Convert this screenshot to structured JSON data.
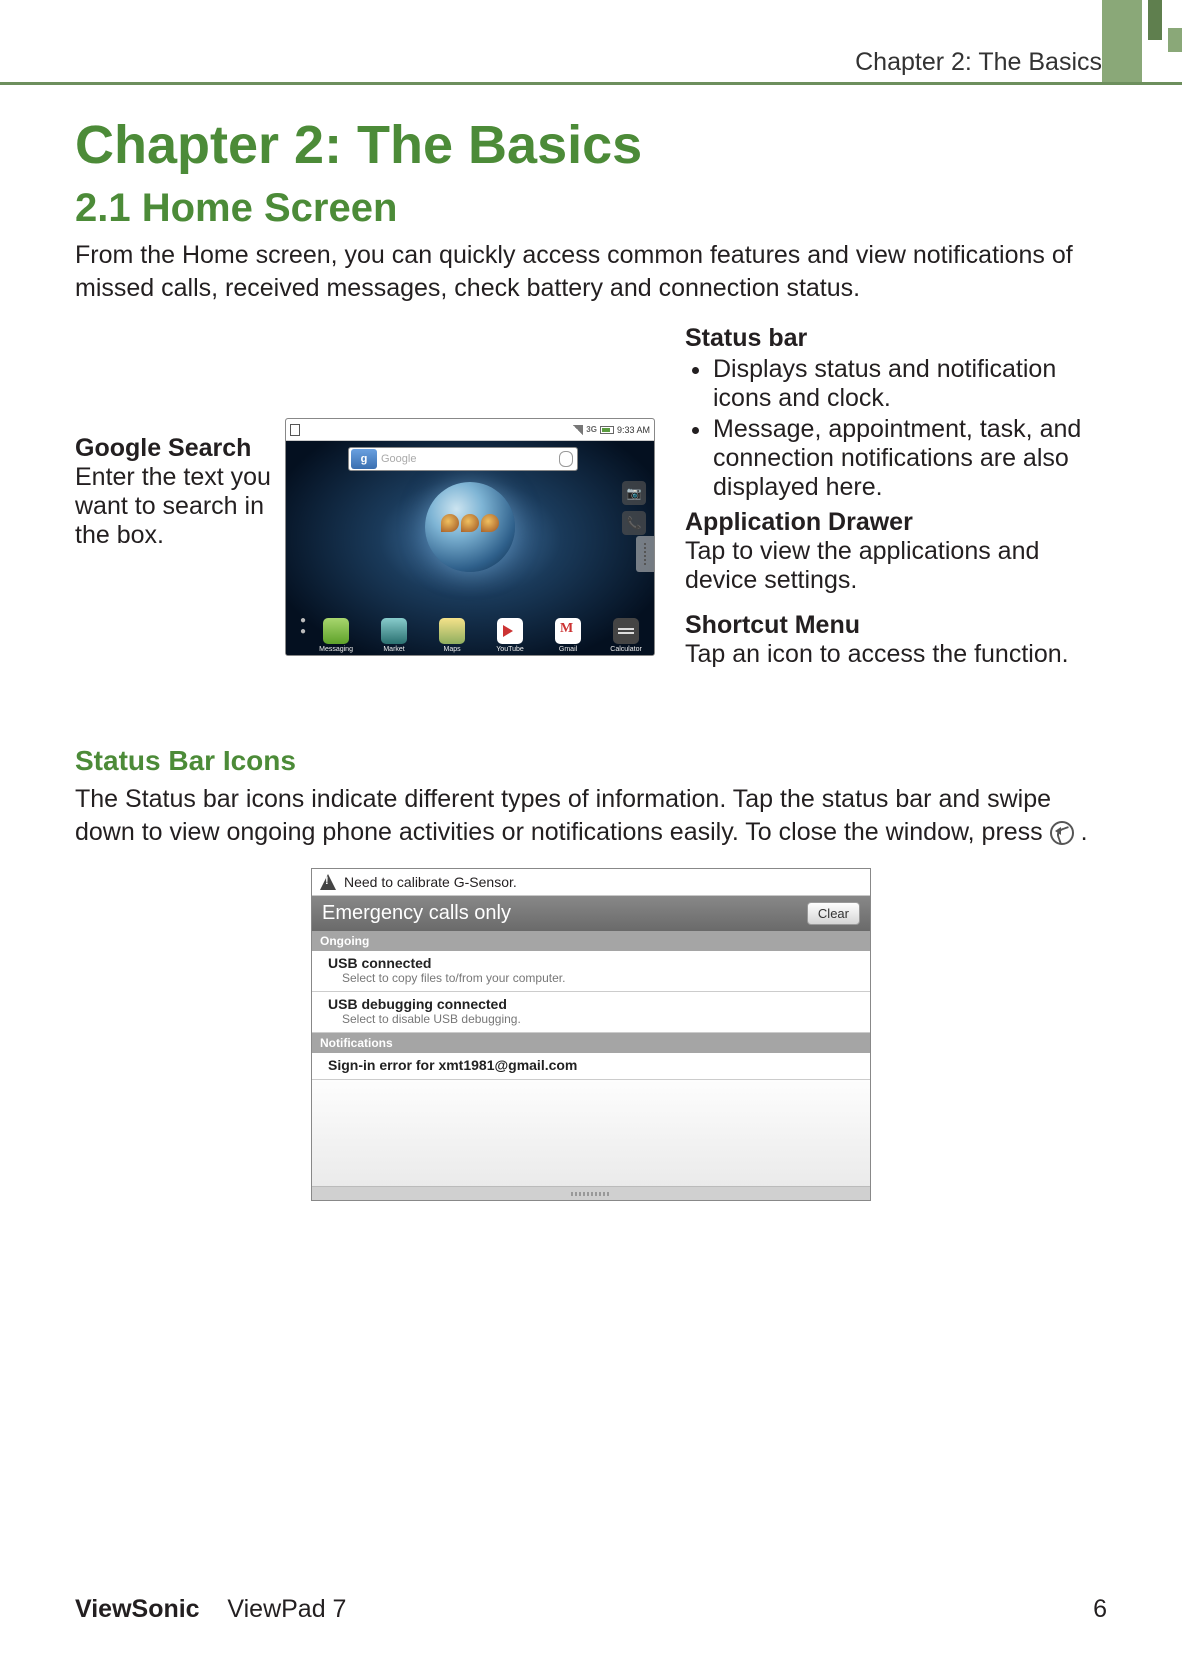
{
  "header": {
    "running": "Chapter 2: The Basics"
  },
  "section": {
    "chapter_title": "Chapter 2: The Basics",
    "h2": "2.1 Home Screen",
    "intro": "From the Home screen, you can quickly access common features and view notifications of missed calls, received messages, check battery and connection status."
  },
  "callouts": {
    "google_search": {
      "title": "Google Search",
      "desc": "Enter the text you want to search in the box."
    },
    "status_bar": {
      "title": "Status bar",
      "bullets": [
        "Displays status and notification icons and clock.",
        "Message, appointment, task, and connection notifications are also displayed here."
      ]
    },
    "app_drawer": {
      "title": "Application Drawer",
      "desc": "Tap to view the applications and device settings."
    },
    "shortcut_menu": {
      "title": "Shortcut Menu",
      "desc": "Tap an icon to access the function."
    }
  },
  "tablet": {
    "status_time": "9:33 AM",
    "search_placeholder": "Google",
    "dock": [
      "Messaging",
      "Market",
      "Maps",
      "YouTube",
      "Gmail",
      "Calculator"
    ]
  },
  "status_icons_section": {
    "h3": "Status Bar Icons",
    "para_before": "The Status bar icons indicate different types of information. Tap the status bar and swipe down to view ongoing phone activities or notifications easily. To close the window, press ",
    "para_after": "."
  },
  "notification_panel": {
    "top_notice": "Need to calibrate G-Sensor.",
    "carrier": "Emergency calls only",
    "clear": "Clear",
    "section_ongoing": "Ongoing",
    "items_ongoing": [
      {
        "title": "USB connected",
        "sub": "Select to copy files to/from your computer."
      },
      {
        "title": "USB debugging connected",
        "sub": "Select to disable USB debugging."
      }
    ],
    "section_notifications": "Notifications",
    "items_notifications": [
      {
        "title": "Sign-in error for xmt1981@gmail.com"
      }
    ]
  },
  "footer": {
    "brand": "ViewSonic",
    "product": "ViewPad 7",
    "page": "6"
  }
}
